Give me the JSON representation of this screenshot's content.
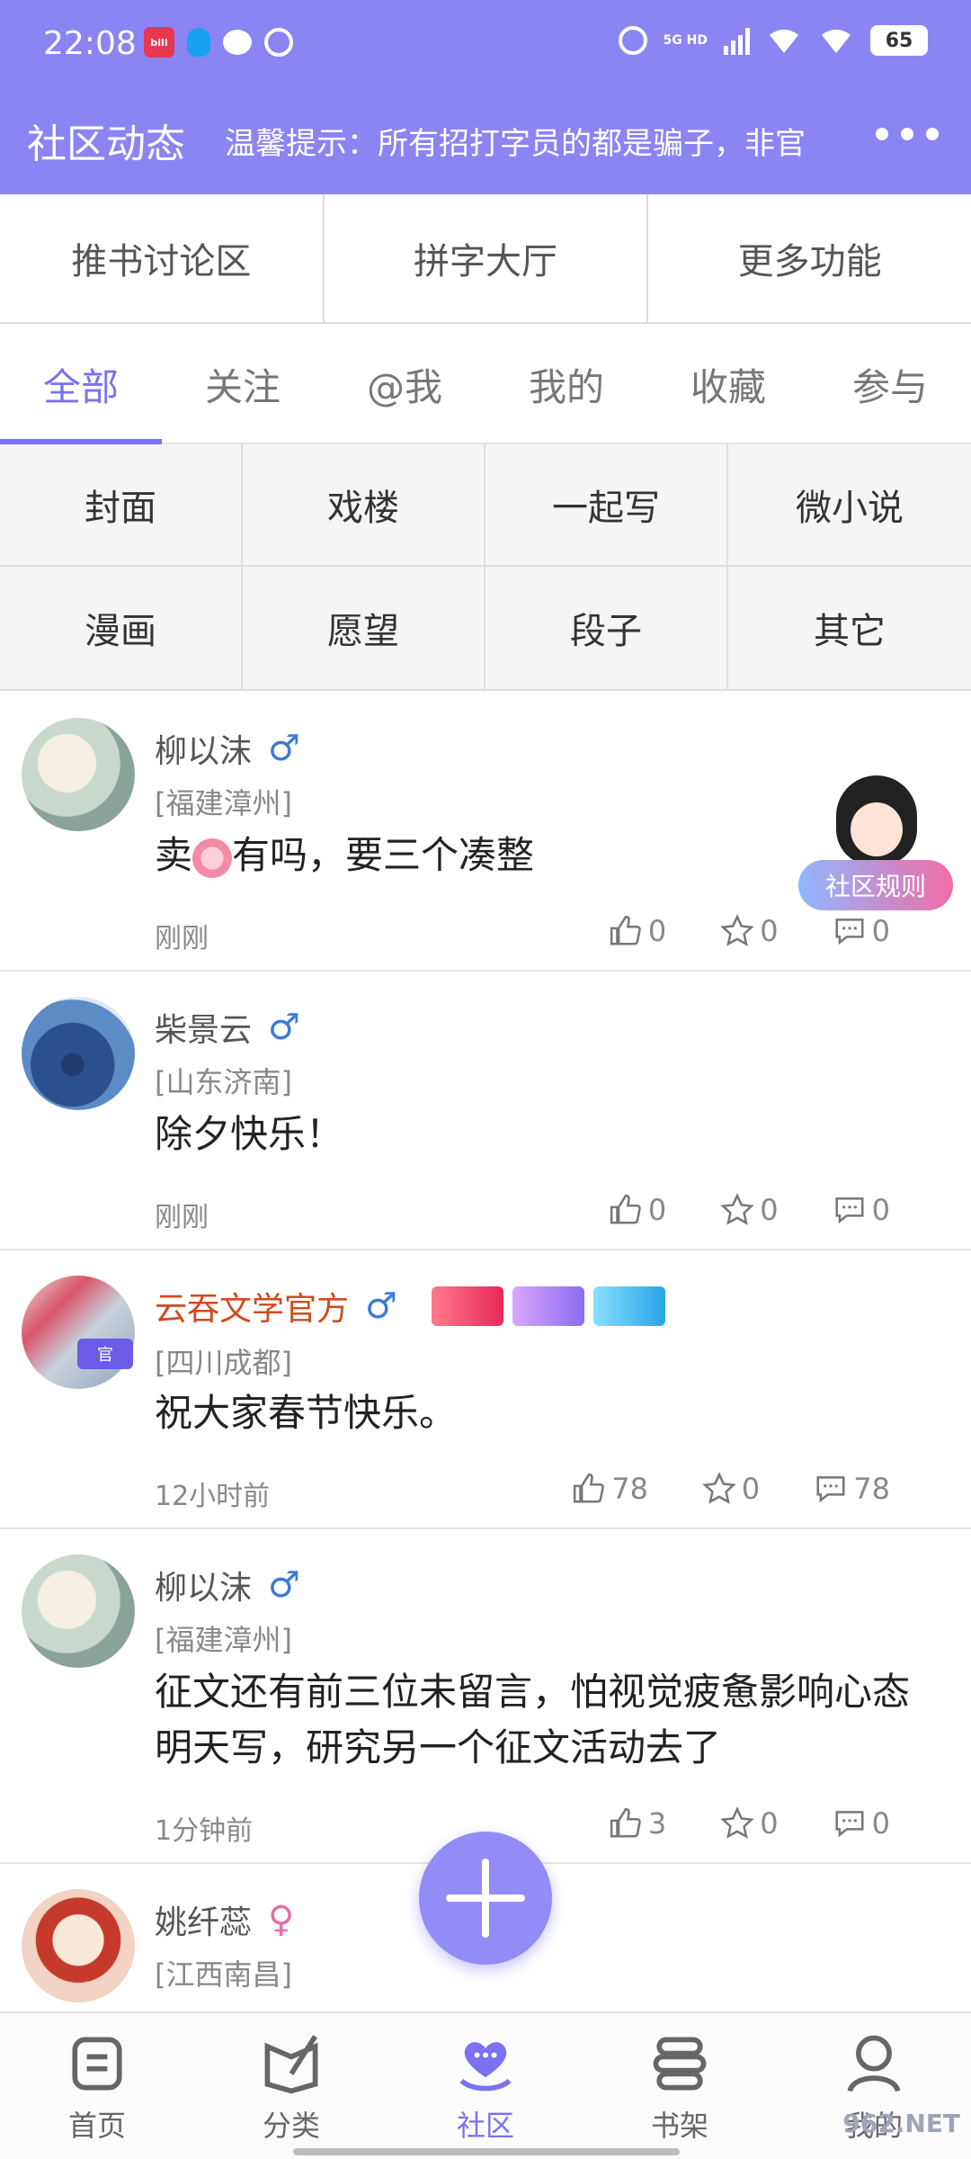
{
  "status": {
    "time": "22:08",
    "network": "5G HD",
    "battery": "65",
    "app_icon_text": "bili"
  },
  "header": {
    "title": "社区动态",
    "marquee": "温馨提示：所有招打字员的都是骗子，非官",
    "more_icon": "more-dots-icon"
  },
  "top_buttons": [
    "推书讨论区",
    "拼字大厅",
    "更多功能"
  ],
  "tabs": [
    "全部",
    "关注",
    "@我",
    "我的",
    "收藏",
    "参与"
  ],
  "active_tab": "全部",
  "categories": [
    "封面",
    "戏楼",
    "一起写",
    "微小说",
    "漫画",
    "愿望",
    "段子",
    "其它"
  ],
  "rules_label": "社区规则",
  "posts": [
    {
      "name": "柳以沫",
      "gender": "♂",
      "location": "[福建漳州]",
      "content_before": "卖",
      "content_after": "有吗，要三个凑整",
      "time": "刚刚",
      "likes": "0",
      "stars": "0",
      "comments": "0"
    },
    {
      "name": "柴景云",
      "gender": "♂",
      "location": "[山东济南]",
      "content": "除夕快乐！",
      "time": "刚刚",
      "likes": "0",
      "stars": "0",
      "comments": "0"
    },
    {
      "name": "云吞文学官方",
      "gender": "♂",
      "location": "[四川成都]",
      "content": "祝大家春节快乐。",
      "time": "12小时前",
      "likes": "78",
      "stars": "0",
      "comments": "78",
      "badge": "官"
    },
    {
      "name": "柳以沫",
      "gender": "♂",
      "location": "[福建漳州]",
      "content": "征文还有前三位未留言，怕视觉疲惫影响心态明天写，研究另一个征文活动去了",
      "time": "1分钟前",
      "likes": "3",
      "stars": "0",
      "comments": "0"
    },
    {
      "name": "姚纤蕊",
      "gender": "♀",
      "location": "[江西南昌]"
    }
  ],
  "bottom_nav": [
    "首页",
    "分类",
    "社区",
    "书架",
    "我的"
  ],
  "active_nav": "社区",
  "watermark": "962.NET",
  "colors": {
    "accent": "#8b84f3",
    "active": "#7a72f0",
    "official_name": "#d04a1c",
    "male": "#3b7bd8",
    "female": "#e96ca8"
  }
}
